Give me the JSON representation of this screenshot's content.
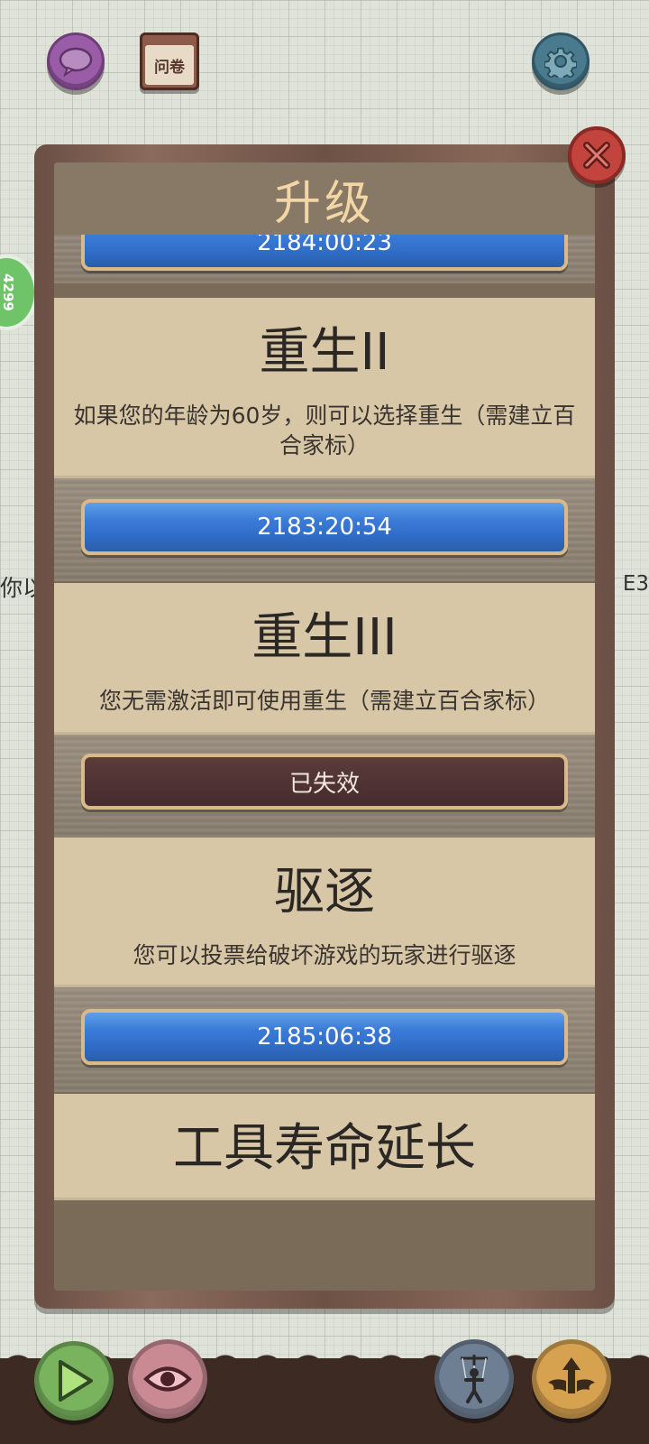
{
  "top_bar": {
    "survey_label": "问卷"
  },
  "side": {
    "score_badge": "4299",
    "bg_text_left": "你以",
    "bg_text_right": "E3"
  },
  "dialog": {
    "title": "升级",
    "top_partial_timer": "2184:00:23",
    "upgrades": [
      {
        "title": "重生II",
        "description": "如果您的年龄为60岁，则可以选择重生（需建立百合家标）",
        "button": "2183:20:54",
        "button_state": "active"
      },
      {
        "title": "重生III",
        "description": "您无需激活即可使用重生（需建立百合家标）",
        "button": "已失效",
        "button_state": "expired"
      },
      {
        "title": "驱逐",
        "description": "您可以投票给破坏游戏的玩家进行驱逐",
        "button": "2185:06:38",
        "button_state": "active"
      },
      {
        "title": "工具寿命延长",
        "description": "",
        "button": "",
        "button_state": "hidden"
      }
    ]
  },
  "colors": {
    "timer_bar": "#3b7bd8",
    "expired_bar": "#452c2c",
    "card_bg": "#d8c7a6",
    "title_color": "#f3d6a6",
    "close_button": "#c2443c"
  },
  "icons": {
    "chat": "speech-bubble-icon",
    "settings": "gear-icon",
    "close": "x-icon",
    "play": "play-triangle-icon",
    "view": "eye-icon",
    "puppet": "marionette-icon",
    "upgrade": "winged-arrow-up-icon"
  }
}
